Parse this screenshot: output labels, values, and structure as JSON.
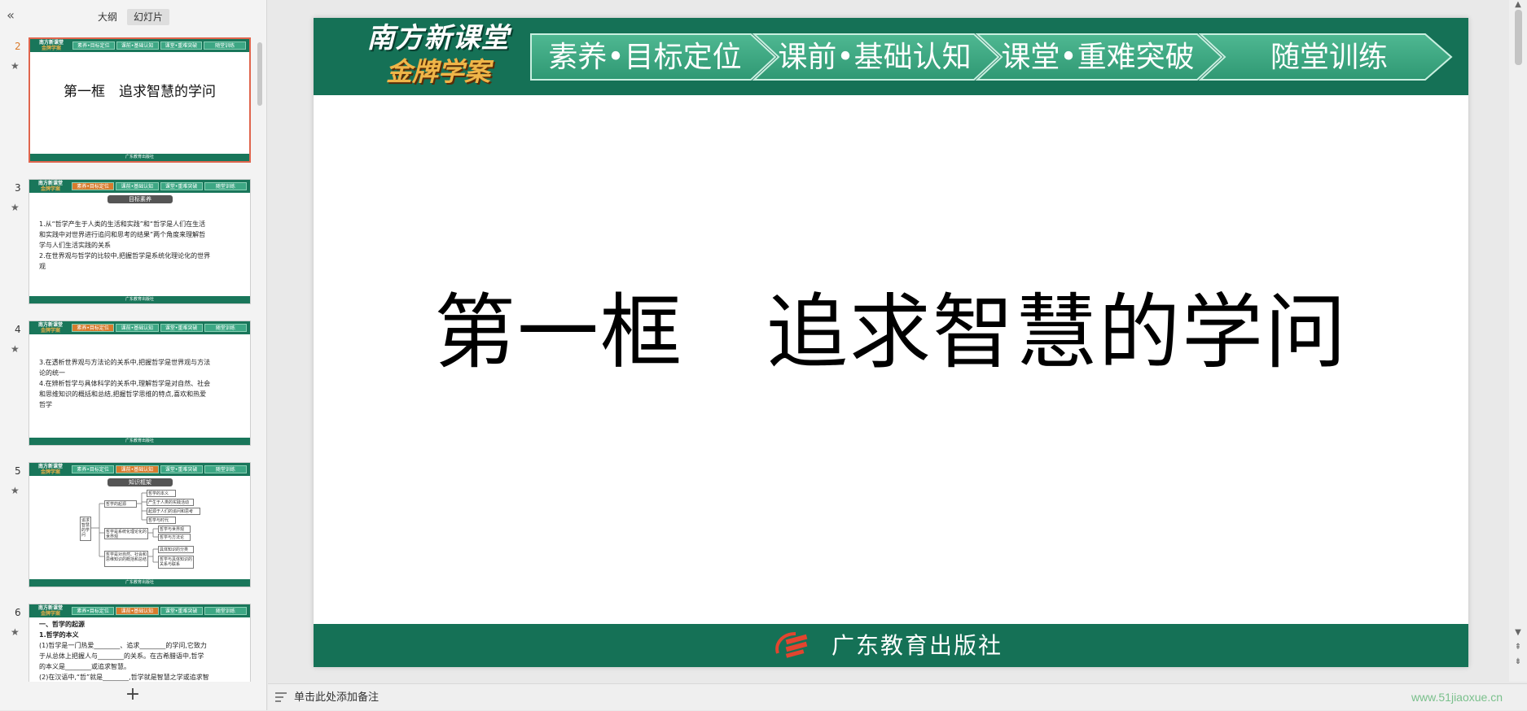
{
  "left_panel": {
    "collapse_icon": "double-chevron-left",
    "view_tabs": [
      {
        "label": "大纲",
        "active": false
      },
      {
        "label": "幻灯片",
        "active": true
      }
    ],
    "add_slide_icon": "plus"
  },
  "thumb_common": {
    "logo_top": "南方新课堂",
    "logo_bottom": "金牌学案",
    "tabs": [
      "素养•目标定位",
      "课前•基础认知",
      "课堂•重难突破",
      "随堂训练"
    ],
    "footer": "广东教育出版社"
  },
  "thumbnails": [
    {
      "number": "2",
      "selected": true,
      "title": "第一框　追求智慧的学问"
    },
    {
      "number": "3",
      "selected": false,
      "banner": "目标素养",
      "lines": [
        "1.从“哲学产生于人类的生活和实践”和“哲学是人们在生活",
        "和实践中对世界进行追问和思考的结果”两个角度来理解哲",
        "学与人们生活实践的关系",
        "2.在世界观与哲学的比较中,把握哲学是系统化理论化的世界",
        "观"
      ]
    },
    {
      "number": "4",
      "selected": false,
      "lines": [
        "3.在透析世界观与方法论的关系中,把握哲学是世界观与方法",
        "论的统一",
        "4.在辨析哲学与具体科学的关系中,理解哲学是对自然、社会",
        "和思维知识的概括和总结,把握哲学思维的特点,喜欢和热爱",
        "哲学"
      ]
    },
    {
      "number": "5",
      "selected": false,
      "banner": "知识框架",
      "diagram": {
        "root": "追求智慧的学问",
        "branches": [
          "哲学的起源",
          "哲学是系统化理论化的世界观",
          "哲学是对自然、社会和思维知识的概括和总结"
        ],
        "leaves": [
          "哲学的本义",
          "产生于人类的实践活动",
          "起源于人们的追问和思考",
          "哲学与时代",
          "哲学与世界观",
          "哲学与方法论",
          "具体知识的分类",
          "哲学与具体知识的关系与联系"
        ]
      }
    },
    {
      "number": "6",
      "selected": false,
      "lines": [
        "一、哲学的起源",
        "1.哲学的本义",
        "(1)哲学是一门热爱________、追求________的学问,它致力",
        "于从总体上把握人与________的关系。在古希腊语中,哲学",
        "的本义是________或追求智慧。",
        "(2)在汉语中,“哲”就是________,哲学就是智慧之学或追求智"
      ]
    }
  ],
  "slide": {
    "header_logo_top": "南方新课堂",
    "header_logo_bottom": "金牌学案",
    "tabs": [
      "素养•目标定位",
      "课前•基础认知",
      "课堂•重难突破",
      "随堂训练"
    ],
    "title": "第一框　追求智慧的学问",
    "publisher": "广东教育出版社"
  },
  "notes_placeholder": "单击此处添加备注",
  "watermark": "www.51jiaoxue.cn",
  "colors": {
    "header_green": "#157156",
    "tab_green": "#3da784",
    "accent_orange": "#e0654d",
    "brand_gold": "#efb548"
  }
}
